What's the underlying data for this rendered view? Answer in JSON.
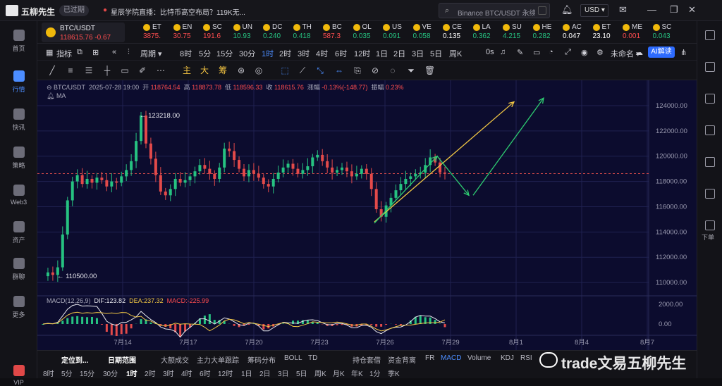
{
  "titlebar": {
    "app_name": "五柳先生",
    "expired_badge": "已过期",
    "news": "星辰学院直播：比特币高空布局？119K无...",
    "search_placeholder": "Binance BTC/USDT 永续",
    "currency": "USD"
  },
  "left_nav": {
    "items": [
      {
        "label": "首页"
      },
      {
        "label": "行情"
      },
      {
        "label": "快讯"
      },
      {
        "label": "策略"
      },
      {
        "label": "Web3"
      },
      {
        "label": "资产"
      },
      {
        "label": "群聊"
      },
      {
        "label": "更多"
      },
      {
        "label": "VIP"
      }
    ]
  },
  "right_rail": {
    "download_label": "下单"
  },
  "tickers": {
    "main": {
      "symbol": "BTC/USDT",
      "price": "118615.76",
      "change": "-0.67"
    },
    "items": [
      {
        "symbol": "ET",
        "price": "3875.",
        "color": "#ff4d4f"
      },
      {
        "symbol": "EN",
        "price": "30.75",
        "color": "#ff4d4f"
      },
      {
        "symbol": "SC",
        "price": "191.6",
        "color": "#ff4d4f"
      },
      {
        "symbol": "UN",
        "price": "10.93",
        "color": "#26c281"
      },
      {
        "symbol": "DC",
        "price": "0.240",
        "color": "#26c281"
      },
      {
        "symbol": "TH",
        "price": "0.418",
        "color": "#26c281"
      },
      {
        "symbol": "BC",
        "price": "587.3",
        "color": "#ff4d4f"
      },
      {
        "symbol": "OL",
        "price": "0.035",
        "color": "#26c281"
      },
      {
        "symbol": "US",
        "price": "0.091",
        "color": "#26c281"
      },
      {
        "symbol": "VE",
        "price": "0.058",
        "color": "#26c281"
      },
      {
        "symbol": "CE",
        "price": "0.135",
        "color": "#ffffff"
      },
      {
        "symbol": "LA",
        "price": "0.362",
        "color": "#26c281"
      },
      {
        "symbol": "SU",
        "price": "4.215",
        "color": "#26c281"
      },
      {
        "symbol": "HE",
        "price": "0.282",
        "color": "#26c281"
      },
      {
        "symbol": "AC",
        "price": "0.047",
        "color": "#ffffff"
      },
      {
        "symbol": "ET",
        "price": "23.10",
        "color": "#ffffff"
      },
      {
        "symbol": "ME",
        "price": "0.001",
        "color": "#ff4d4f"
      },
      {
        "symbol": "SC",
        "price": "0.043",
        "color": "#26c281"
      }
    ]
  },
  "toolbar2": {
    "indicators": "指标",
    "cycle": "周期",
    "timeframes": [
      "8时",
      "5分",
      "15分",
      "30分",
      "1时",
      "2时",
      "3时",
      "4时",
      "6时",
      "12时",
      "1日",
      "2日",
      "3日",
      "5日",
      "周K"
    ],
    "active_timeframe": "1时",
    "zero_s": "0s",
    "unnamed": "未命名",
    "ai_button": "AI解读"
  },
  "toolbar3": {
    "cn_tools": [
      "主",
      "大",
      "筹"
    ]
  },
  "chart_header": {
    "pair": "BTC/USDT",
    "datetime": "2025-07-28 19:00",
    "open_label": "开",
    "open": "118764.54",
    "high_label": "高",
    "high": "118873.78",
    "low_label": "低",
    "low": "118596.33",
    "close_label": "收",
    "close": "118615.76",
    "change_label": "涨幅",
    "change": "-0.13%(-148.77)",
    "amp_label": "振幅",
    "amp": "0.23%",
    "ma_label": "MA"
  },
  "macd": {
    "label": "MACD(12,26,9)",
    "dif": "DIF:123.82",
    "dea": "DEA:237.32",
    "macd": "MACD:-225.99",
    "ticks": [
      "2000.00",
      "0.00"
    ]
  },
  "chart_data": {
    "type": "line",
    "title": "BTC/USDT",
    "xlabel": "",
    "ylabel": "",
    "x_ticks": [
      "7月14",
      "7月17",
      "7月20",
      "7月23",
      "7月26",
      "7月29",
      "8月1",
      "8月4",
      "8月7"
    ],
    "y_ticks": [
      124000,
      122000,
      120000,
      118000,
      116000,
      114000,
      112000,
      110000
    ],
    "ylim": [
      109000,
      125000
    ],
    "annotations": [
      {
        "text": "123218.00",
        "x": "7月14",
        "y": 123218
      },
      {
        "text": "110500.00",
        "x": "7月11",
        "y": 110500
      }
    ],
    "current_price_line": 118615.76,
    "series": [
      {
        "values": [
          110500,
          110800,
          110600,
          111200,
          113800,
          116500,
          118000,
          118500,
          117800,
          118200,
          117900,
          118300,
          118100,
          117600,
          118000,
          117900,
          118400,
          118900,
          119600,
          121200,
          123218,
          121000,
          119800,
          118500,
          117200,
          116900,
          117400,
          118200,
          117900,
          118100,
          118400,
          118800,
          119300,
          119000,
          118600,
          118200,
          119100,
          120600,
          120400,
          119700,
          119000,
          118400,
          118900,
          118600,
          118300,
          117800,
          117600,
          118200,
          118700,
          119100,
          119400,
          119000,
          118600,
          118900,
          119200,
          119900,
          120100,
          119600,
          119100,
          118700,
          118900,
          119100,
          118800,
          118400,
          118600,
          119000,
          118600,
          117400,
          115800,
          115200,
          116100,
          116700,
          117300,
          117800,
          118200,
          118400,
          118600,
          118700,
          119300,
          119900,
          119500,
          118700,
          118615.76
        ]
      }
    ],
    "projections": [
      {
        "color": "#f2c744",
        "from": [
          "7月26",
          114800
        ],
        "to": [
          "8月1",
          124300
        ]
      },
      {
        "color": "#2ecc71",
        "from": [
          "7月26",
          114700
        ],
        "to": [
          "7月28",
          120000
        ]
      },
      {
        "color": "#2ecc71",
        "from": [
          "7月28",
          120000
        ],
        "to": [
          "7月29",
          116900
        ]
      },
      {
        "color": "#2ecc71",
        "from": [
          "7月29",
          116900
        ],
        "to": [
          "8月2",
          124600
        ]
      }
    ]
  },
  "bottom": {
    "bar1": [
      "定位到...",
      "日期范围",
      "大额成交",
      "主力大单跟踪",
      "筹码分布",
      "BOLL",
      "TD",
      "持仓套借",
      "资金背离",
      "FR",
      "MACD",
      "Volume",
      "KDJ",
      "RSI"
    ],
    "bar2": [
      "8时",
      "5分",
      "15分",
      "30分",
      "1时",
      "2时",
      "3时",
      "4时",
      "6时",
      "12时",
      "1日",
      "2日",
      "3日",
      "5日",
      "周K",
      "月K",
      "年K",
      "1分",
      "季K"
    ]
  },
  "watermark": "trade文易五柳先生"
}
